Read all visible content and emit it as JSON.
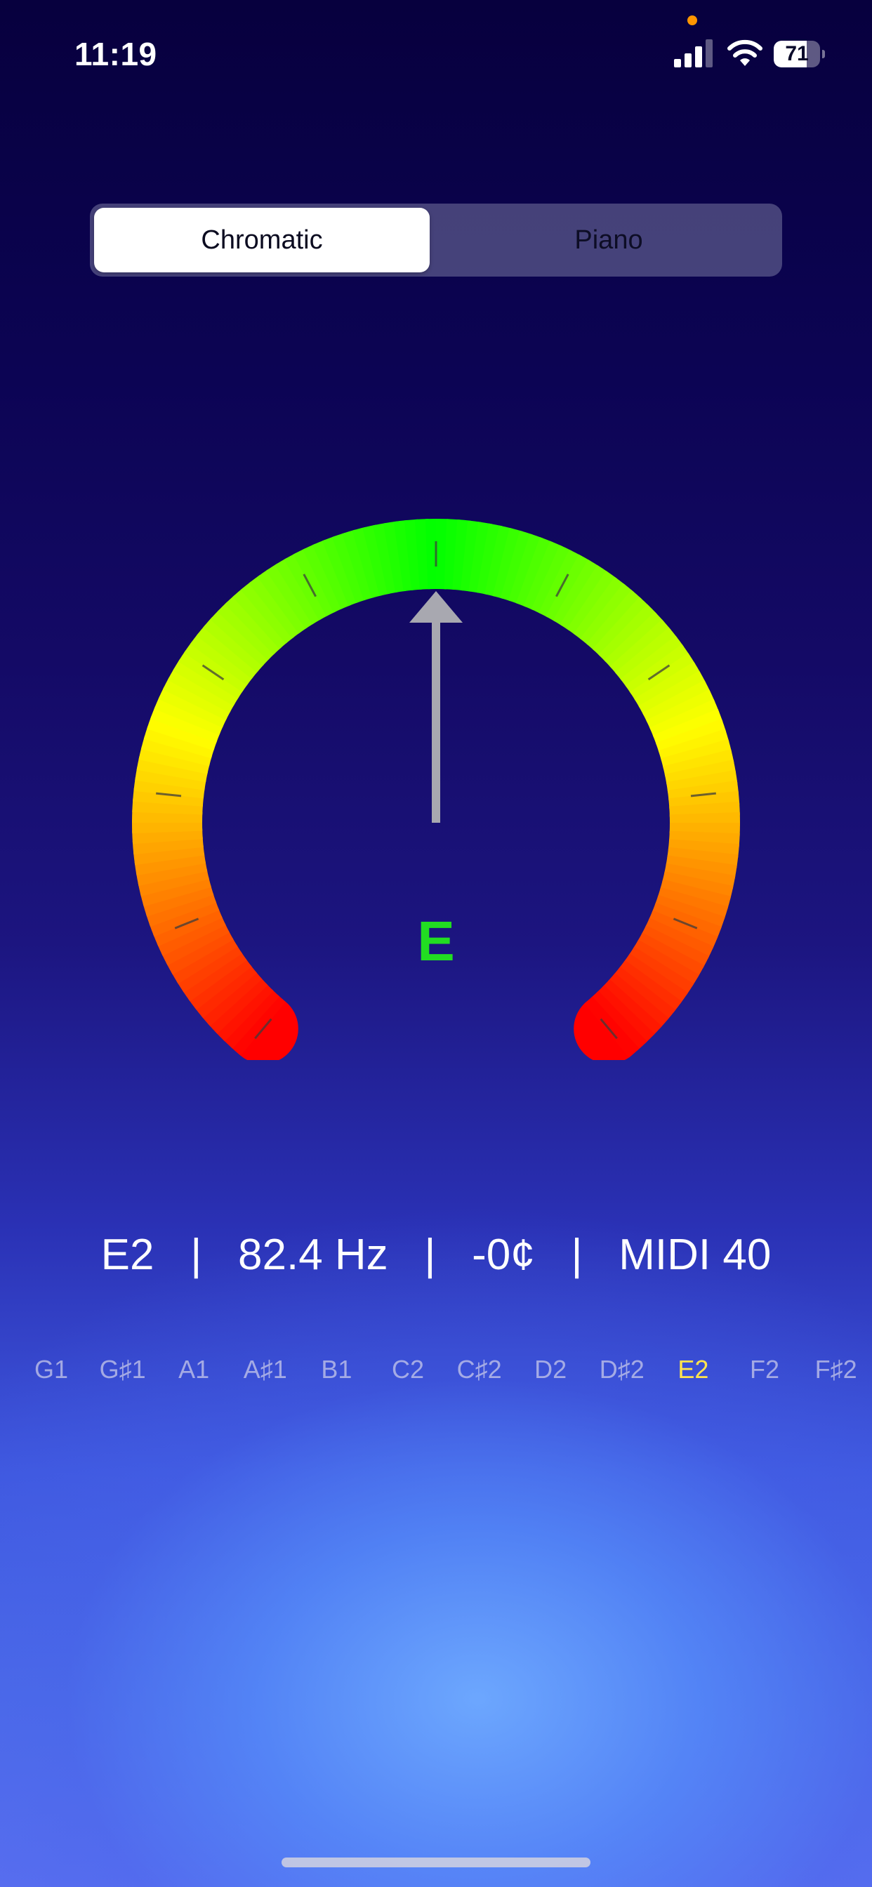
{
  "status_bar": {
    "time": "11:19",
    "battery_percent": "71",
    "battery_level": 0.71,
    "privacy_dot_color": "#ff9500"
  },
  "mode_selector": {
    "options": [
      "Chromatic",
      "Piano"
    ],
    "selected": "Chromatic"
  },
  "tuner": {
    "note": "E",
    "note_color": "#22dd22",
    "needle_cents": 0,
    "gauge_range_cents": [
      -50,
      50
    ],
    "gauge_colors": [
      "#ff0000",
      "#ffff00",
      "#00ff00"
    ],
    "info": {
      "note_octave": "E2",
      "separator": "|",
      "frequency": "82.4 Hz",
      "cents": "-0¢",
      "midi": "MIDI 40"
    },
    "note_strip": [
      "G1",
      "G♯1",
      "A1",
      "A♯1",
      "B1",
      "C2",
      "C♯2",
      "D2",
      "D♯2",
      "E2",
      "F2",
      "F♯2"
    ],
    "active_note": "E2",
    "active_note_color": "#ffe44d"
  }
}
